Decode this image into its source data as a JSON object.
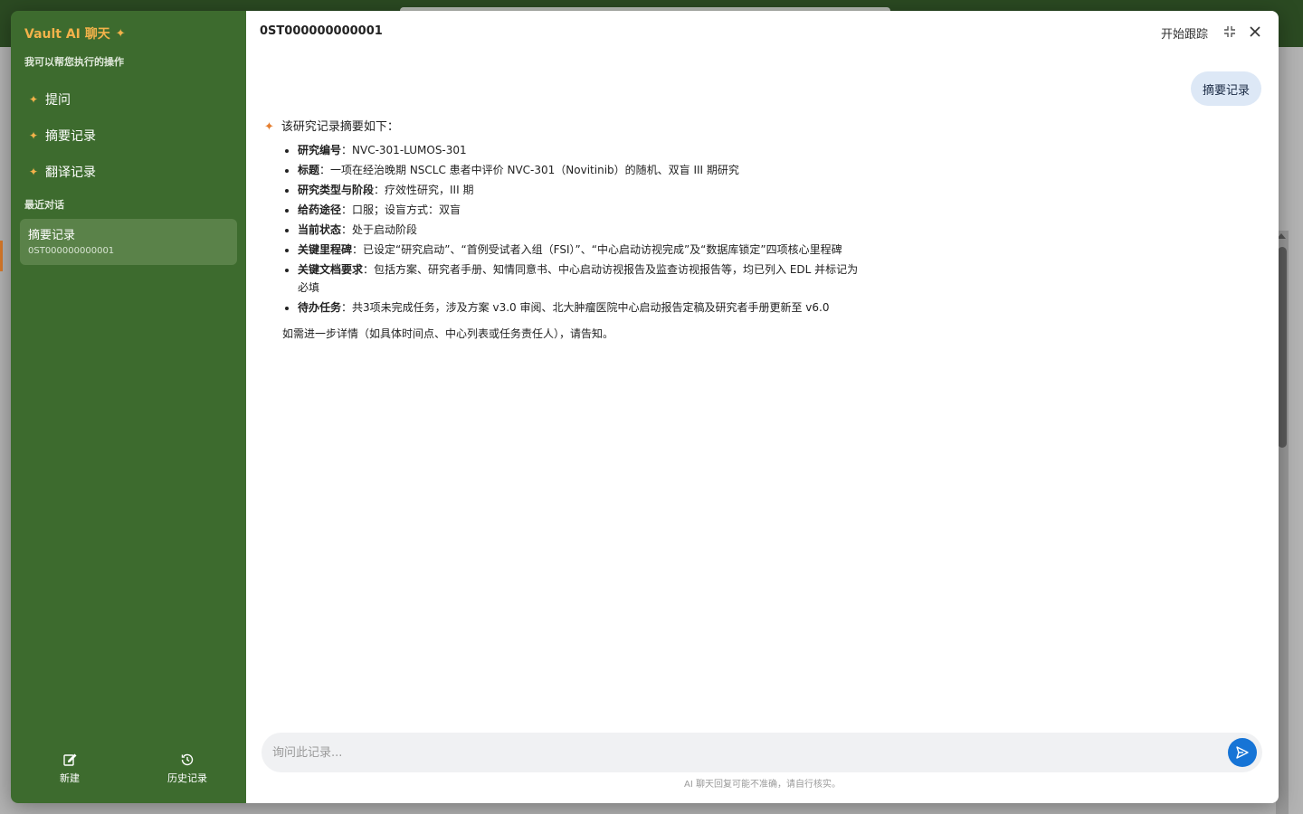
{
  "sidebar": {
    "brand": "Vault AI 聊天",
    "subtitle": "我可以帮您执行的操作",
    "actions": [
      {
        "label": "提问"
      },
      {
        "label": "摘要记录"
      },
      {
        "label": "翻译记录"
      }
    ],
    "recent_label": "最近对话",
    "recent": [
      {
        "title": "摘要记录",
        "record_id": "0ST000000000001"
      }
    ],
    "footer": {
      "new_label": "新建",
      "history_label": "历史记录"
    }
  },
  "header": {
    "record_id": "0ST000000000001",
    "track_label": "开始跟踪"
  },
  "conversation": {
    "user_message": "摘要记录",
    "ai_intro": "该研究记录摘要如下：",
    "ai_items": [
      {
        "key": "研究编号",
        "value": "：NVC-301-LUMOS-301"
      },
      {
        "key": "标题",
        "value": "：一项在经治晚期 NSCLC 患者中评价 NVC-301（Novitinib）的随机、双盲 III 期研究"
      },
      {
        "key": "研究类型与阶段",
        "value": "：疗效性研究，III 期"
      },
      {
        "key": "给药途径",
        "value": "：口服；设盲方式：双盲"
      },
      {
        "key": "当前状态",
        "value": "：处于启动阶段"
      },
      {
        "key": "关键里程碑",
        "value": "：已设定“研究启动”、“首例受试者入组（FSI）”、“中心启动访视完成”及“数据库锁定”四项核心里程碑"
      },
      {
        "key": "关键文档要求",
        "value": "：包括方案、研究者手册、知情同意书、中心启动访视报告及监查访视报告等，均已列入 EDL 并标记为必填"
      },
      {
        "key": "待办任务",
        "value": "：共3项未完成任务，涉及方案 v3.0 审阅、北大肿瘤医院中心启动报告定稿及研究者手册更新至 v6.0"
      }
    ],
    "ai_outro": "如需进一步详情（如具体时间点、中心列表或任务责任人），请告知。"
  },
  "composer": {
    "placeholder": "询问此记录...",
    "disclaimer": "AI 聊天回复可能不准确，请自行核实。"
  },
  "colors": {
    "sidebar_bg": "#3d6b2e",
    "accent_orange": "#f3b24a",
    "send_blue": "#1674d6",
    "user_bubble": "#dde8f6"
  },
  "icons": [
    "sparkle-icon",
    "collapse-icon",
    "close-icon",
    "edit-icon",
    "history-icon",
    "send-icon"
  ]
}
